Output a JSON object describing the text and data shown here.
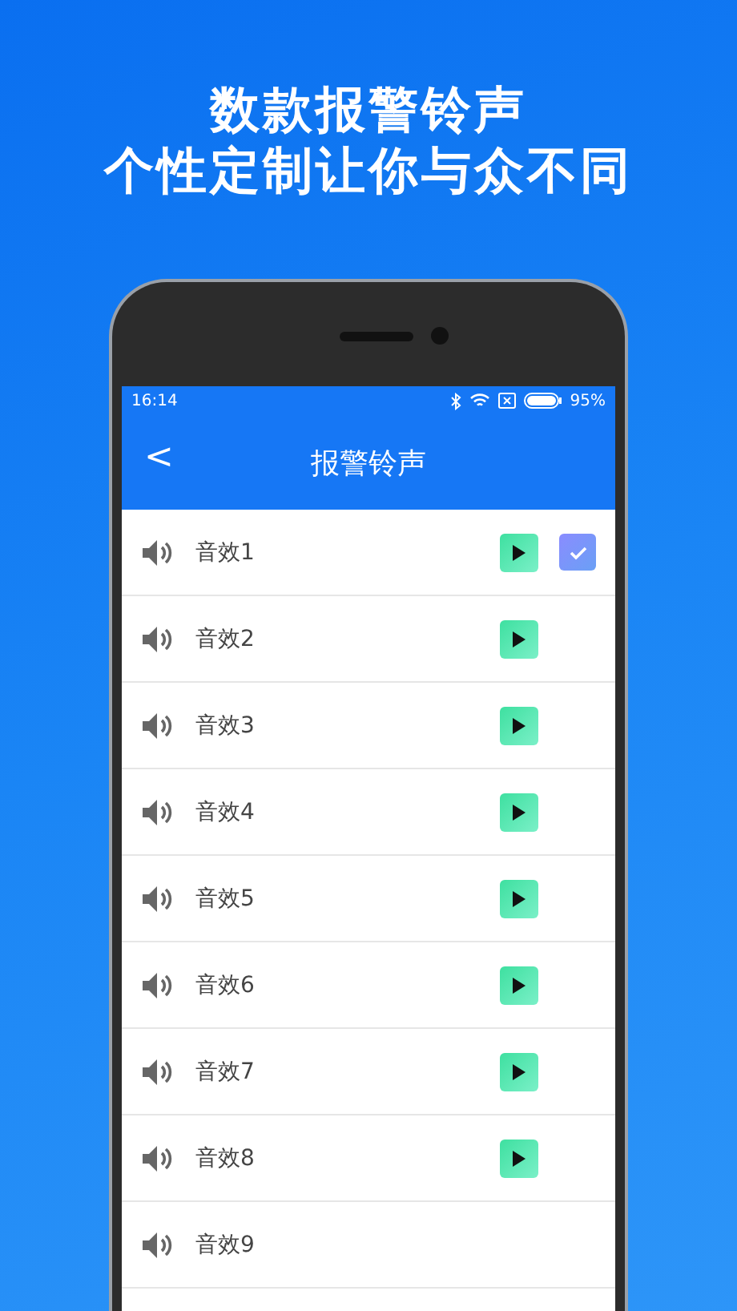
{
  "headline": [
    "数款报警铃声",
    "个性定制让你与众不同"
  ],
  "status_bar": {
    "time": "16:14",
    "battery": "95%"
  },
  "app_bar": {
    "back": "<",
    "title": "报警铃声"
  },
  "sounds": [
    {
      "name": "音效1",
      "selected": true,
      "playable": true
    },
    {
      "name": "音效2",
      "selected": false,
      "playable": true
    },
    {
      "name": "音效3",
      "selected": false,
      "playable": true
    },
    {
      "name": "音效4",
      "selected": false,
      "playable": true
    },
    {
      "name": "音效5",
      "selected": false,
      "playable": true
    },
    {
      "name": "音效6",
      "selected": false,
      "playable": true
    },
    {
      "name": "音效7",
      "selected": false,
      "playable": true
    },
    {
      "name": "音效8",
      "selected": false,
      "playable": true
    },
    {
      "name": "音效9",
      "selected": false,
      "playable": false
    }
  ]
}
